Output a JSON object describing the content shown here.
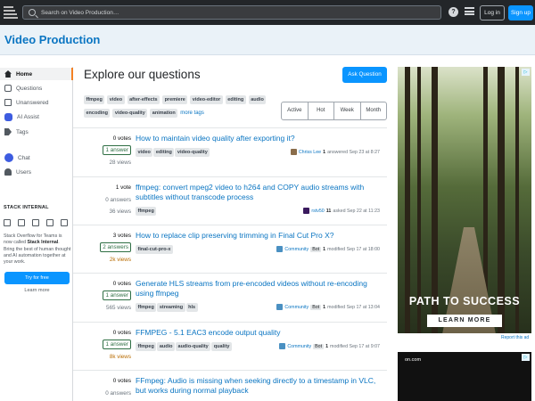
{
  "topbar": {
    "search_placeholder": "Search on Video Production…",
    "login": "Log in",
    "signup": "Sign up",
    "help_icon": "?"
  },
  "header": {
    "site_name": "Video Production"
  },
  "sidebar": {
    "items": [
      {
        "label": "Home",
        "icon": "home-icon"
      },
      {
        "label": "Questions",
        "icon": "questions-icon"
      },
      {
        "label": "Unanswered",
        "icon": "unanswered-icon"
      },
      {
        "label": "AI Assist",
        "icon": "ai-assist-icon"
      },
      {
        "label": "Tags",
        "icon": "tags-icon"
      },
      {
        "label": "Chat",
        "icon": "chat-icon"
      },
      {
        "label": "Users",
        "icon": "users-icon"
      }
    ],
    "stack_internal": {
      "heading": "STACK INTERNAL",
      "text_before": "Stack Overflow for Teams is now called ",
      "text_bold": "Stack Internal",
      "text_after": ". Bring the best of human thought and AI automation together at your work.",
      "try_button": "Try for free",
      "learn_more": "Learn more"
    }
  },
  "main": {
    "title": "Explore our questions",
    "ask_button": "Ask Question",
    "tags": [
      "ffmpeg",
      "video",
      "after-effects",
      "premiere",
      "video-editor",
      "editing",
      "audio",
      "encoding",
      "video-quality",
      "animation"
    ],
    "more_tags": "more tags",
    "filters": [
      "Active",
      "Hot",
      "Week",
      "Month"
    ],
    "questions": [
      {
        "votes": "0 votes",
        "answers": "1 answer",
        "answered": true,
        "views": "28 views",
        "hot": false,
        "title": "How to maintain video quality after exporting it?",
        "tags": [
          "video",
          "editing",
          "video-quality"
        ],
        "user": "Chriss Lee",
        "rep": "1",
        "bot": "",
        "action": "answered Sep 23 at 8:27",
        "avatar_color": "#8a6d4b"
      },
      {
        "votes": "1 vote",
        "answers": "0 answers",
        "answered": false,
        "views": "36 views",
        "hot": false,
        "title": "ffmpeg: convert mpeg2 video to h264 and COPY audio streams with subtitles without transcode process",
        "tags": [
          "ffmpeg"
        ],
        "user": "rstv50",
        "rep": "11",
        "bot": "",
        "action": "asked Sep 22 at 11:23",
        "avatar_color": "#3a1a5e"
      },
      {
        "votes": "3 votes",
        "answers": "2 answers",
        "answered": true,
        "views": "2k views",
        "hot": true,
        "title": "How to replace clip preserving trimming in Final Cut Pro X?",
        "tags": [
          "final-cut-pro-x"
        ],
        "user": "Community",
        "rep": "1",
        "bot": "Bot",
        "action": "modified Sep 17 at 18:00",
        "avatar_color": "#4a90c2"
      },
      {
        "votes": "0 votes",
        "answers": "1 answer",
        "answered": true,
        "views": "565 views",
        "hot": false,
        "title": "Generate HLS streams from pre-encoded videos without re-encoding using ffmpeg",
        "tags": [
          "ffmpeg",
          "streaming",
          "hls"
        ],
        "user": "Community",
        "rep": "1",
        "bot": "Bot",
        "action": "modified Sep 17 at 13:04",
        "avatar_color": "#4a90c2"
      },
      {
        "votes": "0 votes",
        "answers": "1 answer",
        "answered": true,
        "views": "8k views",
        "hot": true,
        "title": "FFMPEG - 5.1 EAC3 encode output quality",
        "tags": [
          "ffmpeg",
          "audio",
          "audio-quality",
          "quality"
        ],
        "user": "Community",
        "rep": "1",
        "bot": "Bot",
        "action": "modified Sep 17 at 9:07",
        "avatar_color": "#4a90c2"
      },
      {
        "votes": "0 votes",
        "answers": "0 answers",
        "answered": false,
        "views": "",
        "hot": false,
        "title": "FFmpeg: Audio is missing when seeking directly to a timestamp in VLC, but works during normal playback",
        "tags": [],
        "user": "",
        "rep": "",
        "bot": "",
        "action": "",
        "avatar_color": "#4a90c2"
      }
    ]
  },
  "ads": {
    "ad1_headline": "PATH TO SUCCESS",
    "ad1_cta": "LEARN MORE",
    "report_ad": "Report this ad",
    "ad2_brand": "on.com",
    "adchoice_icon": "▷"
  },
  "colors": {
    "accent": "#0a95ff",
    "link": "#0a75c2",
    "topbar": "#232629",
    "header": "#eaf2f8",
    "answered": "#2f6f44",
    "hot": "#b86b00"
  }
}
